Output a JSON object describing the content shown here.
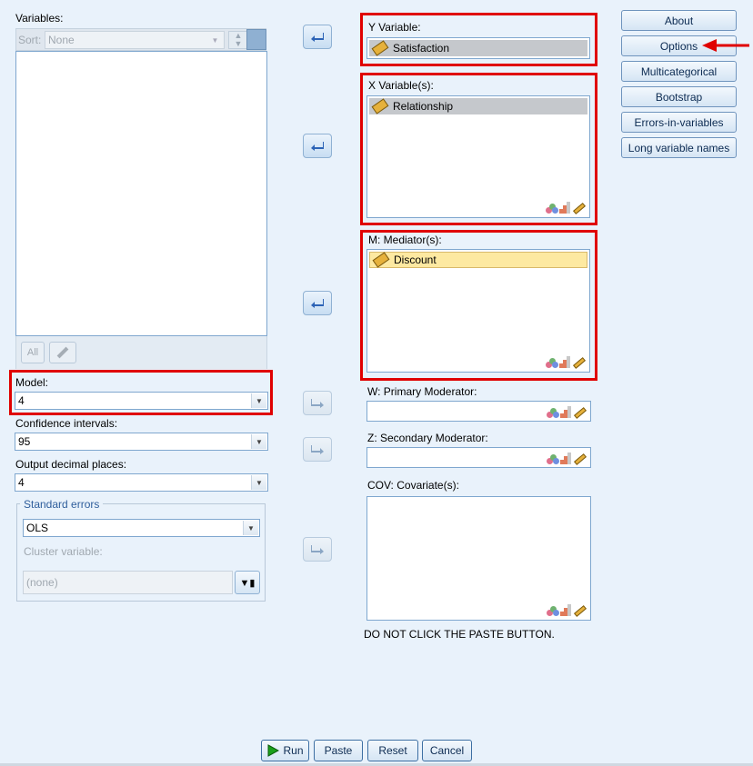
{
  "left": {
    "variables_label": "Variables:",
    "sort_label": "Sort:",
    "sort_value": "None",
    "all_button": "All",
    "model_label": "Model:",
    "model_value": "4",
    "ci_label": "Confidence intervals:",
    "ci_value": "95",
    "decimals_label": "Output decimal places:",
    "decimals_value": "4",
    "std_errors_legend": "Standard errors",
    "std_errors_value": "OLS",
    "cluster_label": "Cluster variable:",
    "cluster_value": "(none)"
  },
  "center": {
    "y_label": "Y Variable:",
    "y_item": "Satisfaction",
    "x_label": "X Variable(s):",
    "x_item": "Relationship",
    "m_label": "M: Mediator(s):",
    "m_item": "Discount",
    "w_label": "W: Primary Moderator:",
    "z_label": "Z: Secondary Moderator:",
    "cov_label": "COV: Covariate(s):",
    "note": "DO NOT CLICK THE PASTE BUTTON."
  },
  "side_buttons": [
    "About",
    "Options",
    "Multicategorical",
    "Bootstrap",
    "Errors-in-variables",
    "Long variable names"
  ],
  "bottom_buttons": {
    "run": "Run",
    "paste": "Paste",
    "reset": "Reset",
    "cancel": "Cancel"
  },
  "colors": {
    "highlight_box": "#e00000",
    "annotation_arrow": "#e00000"
  }
}
